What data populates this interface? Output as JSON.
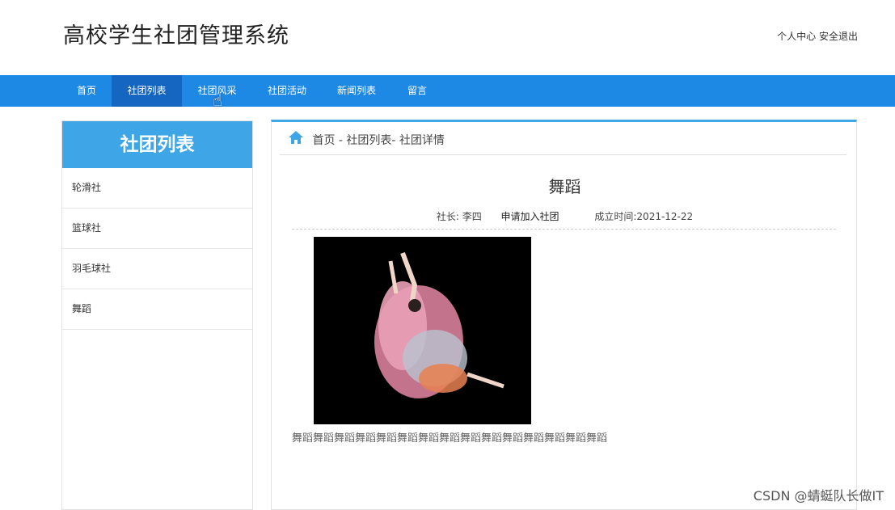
{
  "header": {
    "site_title": "高校学生社团管理系统",
    "user_center": "个人中心",
    "logout": "安全退出"
  },
  "nav": {
    "items": [
      "首页",
      "社团列表",
      "社团风采",
      "社团活动",
      "新闻列表",
      "留言"
    ],
    "active_index": 1
  },
  "sidebar": {
    "title": "社团列表",
    "items": [
      "轮滑社",
      "篮球社",
      "羽毛球社",
      "舞蹈"
    ]
  },
  "breadcrumb": {
    "text": "首页 - 社团列表- 社团详情"
  },
  "detail": {
    "title": "舞蹈",
    "president_label": "社长:",
    "president": "李四",
    "apply_label": "申请加入社团",
    "founded_label": "成立时间:",
    "founded": "2021-12-22",
    "description": "舞蹈舞蹈舞蹈舞蹈舞蹈舞蹈舞蹈舞蹈舞蹈舞蹈舞蹈舞蹈舞蹈舞蹈舞蹈"
  },
  "watermark": "CSDN @蜻蜓队长做IT",
  "colors": {
    "nav_bg": "#1e88e5",
    "nav_active": "#1466c0",
    "accent": "#3ea6e6"
  }
}
